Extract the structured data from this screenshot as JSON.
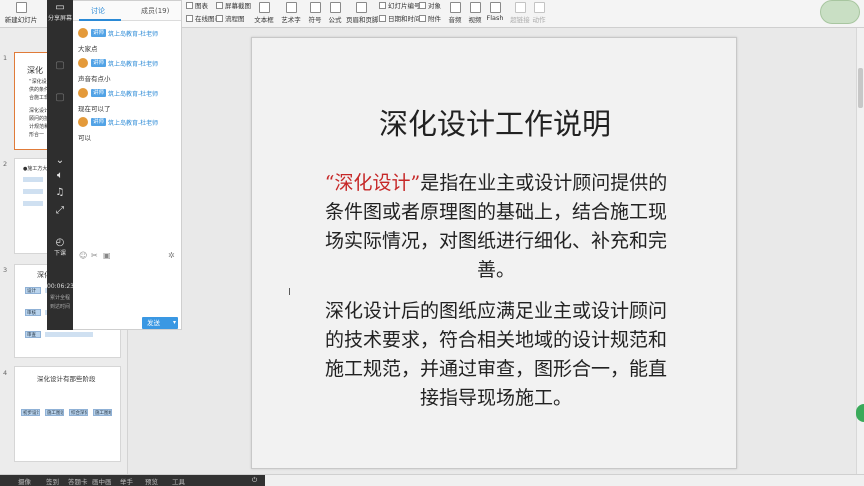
{
  "ribbon": {
    "new_slide": "新建幻灯片",
    "chart": "图表",
    "screenshot": "屏幕截图",
    "online_chart": "在线图表",
    "flowchart": "流程图",
    "textbox": "文本框",
    "wordart": "艺术字",
    "symbol": "符号",
    "formula": "公式",
    "header_footer": "页眉和页脚",
    "slide_number": "幻灯片编号",
    "datetime": "日期和时间",
    "object": "对象",
    "attachment": "附件",
    "audio": "音频",
    "video": "视频",
    "flash": "Flash",
    "hyperlink": "超链接",
    "action": "动作"
  },
  "live": {
    "share_screen": "分享屏幕",
    "dl": "下课",
    "time": "00:06:23",
    "time_label1": "累计全程",
    "time_label2": "到达时间"
  },
  "chat": {
    "tab_discuss": "讨论",
    "tab_members": "成员(19)",
    "messages": [
      {
        "tag": "讲师",
        "name": "筑上岛教育-杜老师",
        "text": "大家点"
      },
      {
        "tag": "讲师",
        "name": "筑上岛教育-杜老师",
        "text": "声音有点小"
      },
      {
        "tag": "讲师",
        "name": "筑上岛教育-杜老师",
        "text": "现在可以了"
      },
      {
        "tag": "讲师",
        "name": "筑上岛教育-杜老师",
        "text": "可以"
      }
    ],
    "send": "发送"
  },
  "thumbs": {
    "n1": "1",
    "n2": "2",
    "n3": "3",
    "n4": "4",
    "t1_title": "深化",
    "t1_l1": "“深化设",
    "t1_l2": "供的条件",
    "t1_l3": "合施工现",
    "t1_l4": "深化设计",
    "t1_l5": "顾问的技",
    "t1_l6": "计规范和",
    "t1_l7": "形合一",
    "t2_title": "●施工方大",
    "t3_title": "深化",
    "t3_p1": "设计",
    "t3_p2": "审核",
    "t3_p3": "审查",
    "t4_title": "深化设计有那些阶段",
    "t4_p1": "初步设计",
    "t4_p2": "施工图设计阶段",
    "t4_p3": "综合深化设计阶段",
    "t4_p4": "施工图竣工图"
  },
  "slide": {
    "title": "深化设计工作说明",
    "p1_quote": "“深化设计”",
    "p1_rest": "是指在业主或设计顾问提供的条件图或者原理图的基础上，结合施工现场实际情况，对图纸进行细化、补充和完善。",
    "p2": "深化设计后的图纸应满足业主或设计顾问的技术要求，符合相关地域的设计规范和施工规范，并通过审查，图形合一，能直接指导现场施工。"
  },
  "status": {
    "items": [
      "摄像",
      "签到",
      "答题卡",
      "画中画",
      "举手",
      "预览",
      "工具"
    ]
  },
  "colors": {
    "accent_blue": "#2b8ad6",
    "quote_red": "#c62828",
    "live_dark": "#2e2e2e"
  }
}
